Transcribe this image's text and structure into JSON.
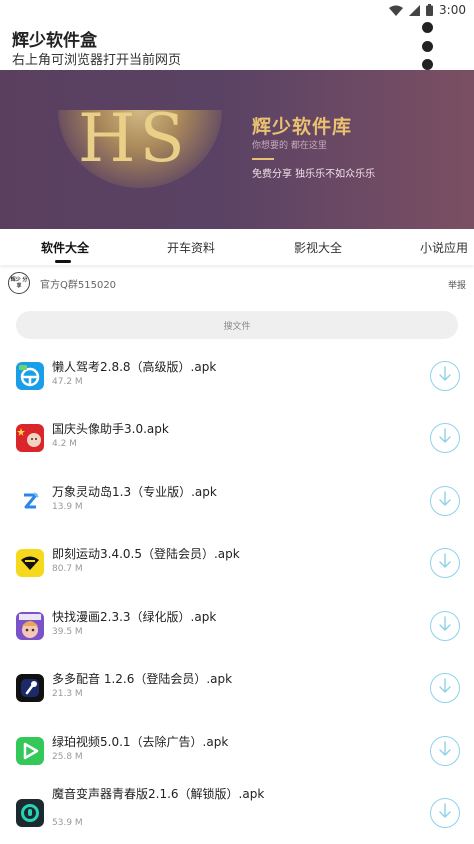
{
  "status_bar": {
    "time": "3:00"
  },
  "header": {
    "title": "辉少软件盒",
    "subtitle": "右上角可浏览器打开当前网页"
  },
  "banner": {
    "logo_text": "HS",
    "name": "辉少软件库",
    "sub": "你想要的 都在这里",
    "tagline": "免费分享 独乐乐不如众乐乐"
  },
  "tabs": [
    {
      "label": "软件大全"
    },
    {
      "label": "开车资料"
    },
    {
      "label": "影视大全"
    },
    {
      "label": "小说应用"
    }
  ],
  "notice": {
    "avatar_text": "辉少 分享",
    "text": "官方Q群515020",
    "report": "举报"
  },
  "search": {
    "placeholder": "搜文件"
  },
  "items": [
    {
      "name": "懒人驾考2.8.8（高级版）.apk",
      "size": "47.2 M",
      "icon": "car-wheel-icon",
      "color": "#1a9ee8"
    },
    {
      "name": "国庆头像助手3.0.apk",
      "size": "4.2 M",
      "icon": "flag-avatar-icon",
      "color": "#d9252b"
    },
    {
      "name": "万象灵动岛1.3（专业版）.apk",
      "size": "13.9 M",
      "icon": "island-z-icon",
      "color": "#2b86e8"
    },
    {
      "name": "即刻运动3.4.0.5（登陆会员）.apk",
      "size": "80.7 M",
      "icon": "sport-icon",
      "color": "#f6d91c"
    },
    {
      "name": "快找漫画2.3.3（绿化版）.apk",
      "size": "39.5 M",
      "icon": "comic-icon",
      "color": "#7b53c9"
    },
    {
      "name": "多多配音 1.2.6（登陆会员）.apk",
      "size": "21.3 M",
      "icon": "microphone-icon",
      "color": "#111111"
    },
    {
      "name": "绿珀视频5.0.1（去除广告）.apk",
      "size": "25.8 M",
      "icon": "play-icon",
      "color": "#34c759"
    },
    {
      "name": "魔音变声器青春版2.1.6（解锁版）.apk",
      "size": "53.9 M",
      "icon": "voice-changer-icon",
      "color": "#1c2a2f"
    }
  ]
}
